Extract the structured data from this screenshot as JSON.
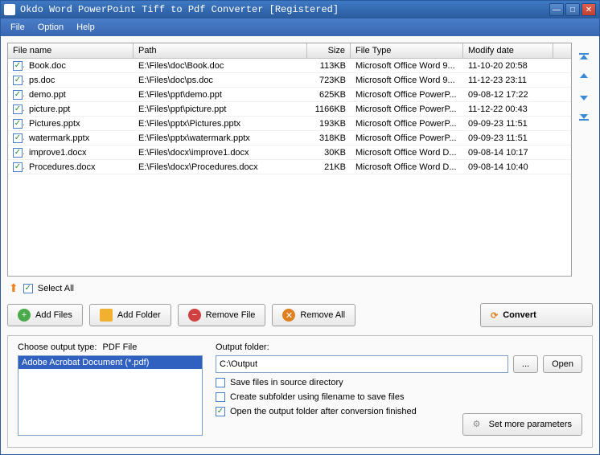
{
  "title": "Okdo Word PowerPoint Tiff to Pdf Converter [Registered]",
  "menu": {
    "file": "File",
    "option": "Option",
    "help": "Help"
  },
  "columns": {
    "name": "File name",
    "path": "Path",
    "size": "Size",
    "type": "File Type",
    "date": "Modify date"
  },
  "files": [
    {
      "checked": true,
      "name": "Book.doc",
      "path": "E:\\Files\\doc\\Book.doc",
      "size": "113KB",
      "type": "Microsoft Office Word 9...",
      "date": "11-10-20 20:58"
    },
    {
      "checked": true,
      "name": "ps.doc",
      "path": "E:\\Files\\doc\\ps.doc",
      "size": "723KB",
      "type": "Microsoft Office Word 9...",
      "date": "11-12-23 23:11"
    },
    {
      "checked": true,
      "name": "demo.ppt",
      "path": "E:\\Files\\ppt\\demo.ppt",
      "size": "625KB",
      "type": "Microsoft Office PowerP...",
      "date": "09-08-12 17:22"
    },
    {
      "checked": true,
      "name": "picture.ppt",
      "path": "E:\\Files\\ppt\\picture.ppt",
      "size": "1166KB",
      "type": "Microsoft Office PowerP...",
      "date": "11-12-22 00:43"
    },
    {
      "checked": true,
      "name": "Pictures.pptx",
      "path": "E:\\Files\\pptx\\Pictures.pptx",
      "size": "193KB",
      "type": "Microsoft Office PowerP...",
      "date": "09-09-23 11:51"
    },
    {
      "checked": true,
      "name": "watermark.pptx",
      "path": "E:\\Files\\pptx\\watermark.pptx",
      "size": "318KB",
      "type": "Microsoft Office PowerP...",
      "date": "09-09-23 11:51"
    },
    {
      "checked": true,
      "name": "improve1.docx",
      "path": "E:\\Files\\docx\\improve1.docx",
      "size": "30KB",
      "type": "Microsoft Office Word D...",
      "date": "09-08-14 10:17"
    },
    {
      "checked": true,
      "name": "Procedures.docx",
      "path": "E:\\Files\\docx\\Procedures.docx",
      "size": "21KB",
      "type": "Microsoft Office Word D...",
      "date": "09-08-14 10:40"
    }
  ],
  "select_all": {
    "checked": true,
    "label": "Select All"
  },
  "buttons": {
    "add_files": "Add Files",
    "add_folder": "Add Folder",
    "remove_file": "Remove File",
    "remove_all": "Remove All",
    "convert": "Convert",
    "browse": "...",
    "open": "Open",
    "set_more": "Set more parameters"
  },
  "output": {
    "choose_type_label": "Choose output type:",
    "type_value": "PDF File",
    "list_item": "Adobe Acrobat Document (*.pdf)",
    "folder_label": "Output folder:",
    "folder_value": "C:\\Output",
    "save_source": {
      "checked": false,
      "label": "Save files in source directory"
    },
    "create_sub": {
      "checked": false,
      "label": "Create subfolder using filename to save files"
    },
    "open_after": {
      "checked": true,
      "label": "Open the output folder after conversion finished"
    }
  }
}
